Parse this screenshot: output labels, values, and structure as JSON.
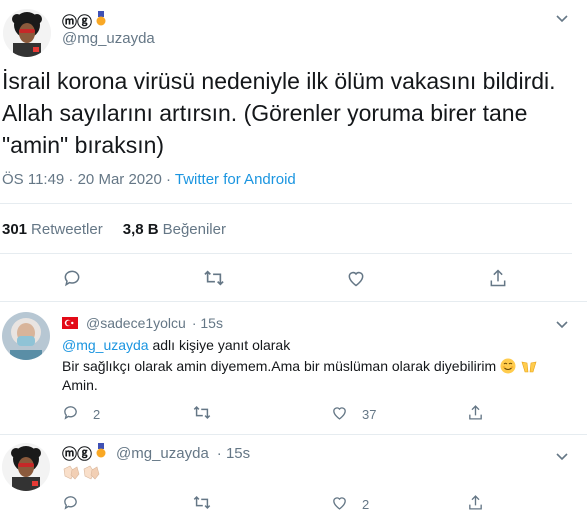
{
  "main_tweet": {
    "display_name": "ⓜⓖ",
    "handle": "@mg_uzayda",
    "text_lines": [
      "İsrail korona virüsü nedeniyle ilk ölüm vakasını bildirdi.",
      "Allah sayılarını artırsın. (Görenler yoruma birer tane",
      "\"amin\" bıraksın)"
    ],
    "time_date": "ÖS 11:49 · 20 Mar 2020 · ",
    "source": "Twitter for Android",
    "retweets_count": "301",
    "retweets_label": "Retweetler",
    "likes_count": "3,8 B",
    "likes_label": "Beğeniler"
  },
  "reply_1": {
    "handle": "@sadece1yolcu",
    "time": "· 15s",
    "reply_to_handle": "@mg_uzayda",
    "reply_to_suffix": " adlı kişiye yanıt olarak",
    "text_line1": "Bir sağlıkçı olarak amin diyemem.Ama bir müslüman olarak diyebilirim",
    "text_line2": "Amin.",
    "reply_count": "2",
    "like_count": "37"
  },
  "reply_2": {
    "display_name": "ⓜⓖ",
    "handle": "@mg_uzayda",
    "time": "· 15s",
    "like_count": "2"
  },
  "icons": {
    "chevron": "chevron-down-icon",
    "reply": "reply-icon",
    "retweet": "retweet-icon",
    "like": "heart-icon",
    "share": "share-icon"
  },
  "colors": {
    "accent": "#1b95e0",
    "muted": "#657786",
    "separator": "#e6ecf0"
  }
}
